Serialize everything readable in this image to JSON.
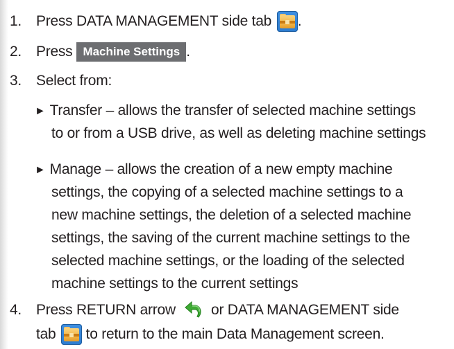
{
  "steps": [
    {
      "number": "1.",
      "text_before": "Press DATA MANAGEMENT side tab",
      "text_after": "."
    },
    {
      "number": "2.",
      "text_before": "Press",
      "button_label": "Machine Settings",
      "text_after": "."
    },
    {
      "number": "3.",
      "text": "Select from:"
    },
    {
      "number": "4.",
      "line1_before": "Press RETURN arrow",
      "line1_after": "or DATA MANAGEMENT side",
      "line2_before": "tab",
      "line2_after": "to return to the main Data Management screen."
    }
  ],
  "options": [
    {
      "arrow": "►",
      "lines": [
        "Transfer – allows the transfer of selected machine settings",
        "to or from a USB drive, as well as deleting machine settings"
      ]
    },
    {
      "arrow": "►",
      "lines": [
        "Manage – allows the creation of a new empty machine",
        "settings, the copying of a selected machine settings to a",
        "new machine settings, the deletion of a selected machine",
        "settings, the saving of the current machine settings to the",
        "selected machine settings, or the loading of the selected",
        "machine settings to the current settings"
      ]
    }
  ],
  "icons": {
    "data_management": "data-management-tab-icon",
    "return": "return-arrow-icon"
  },
  "colors": {
    "text": "#231f20",
    "button_bg": "#6d6e71",
    "icon_blue": "#2c7cd1",
    "icon_folder": "#f2b648",
    "return_green": "#3faa35"
  }
}
